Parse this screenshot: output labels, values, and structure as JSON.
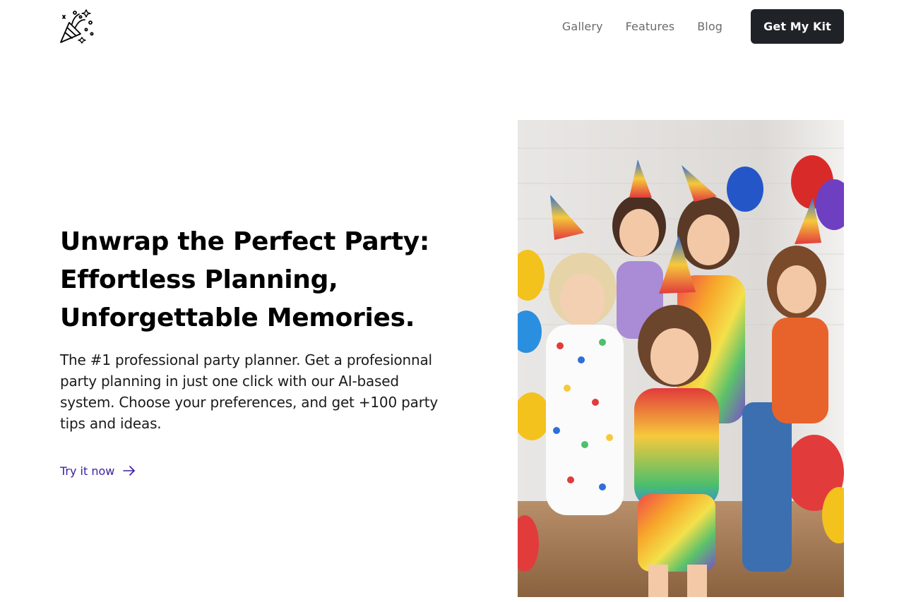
{
  "header": {
    "logo_icon": "party-popper-icon",
    "nav": [
      "Gallery",
      "Features",
      "Blog"
    ],
    "cta_label": "Get My Kit"
  },
  "hero": {
    "title_lines": [
      "Unwrap the Perfect Party:",
      "Effortless Planning,",
      "Unforgettable Memories."
    ],
    "description": "The #1 professional party planner. Get a profesionnal party planning in just one click with our AI-based system. Choose your preferences, and get +100 party tips and ideas.",
    "link_label": "Try it now",
    "link_icon": "arrow-right-icon",
    "image": "children-birthday-party-photo"
  },
  "colors": {
    "cta_bg": "#1f2328",
    "link": "#3b1fa0",
    "nav_text": "#6b6b6b"
  }
}
